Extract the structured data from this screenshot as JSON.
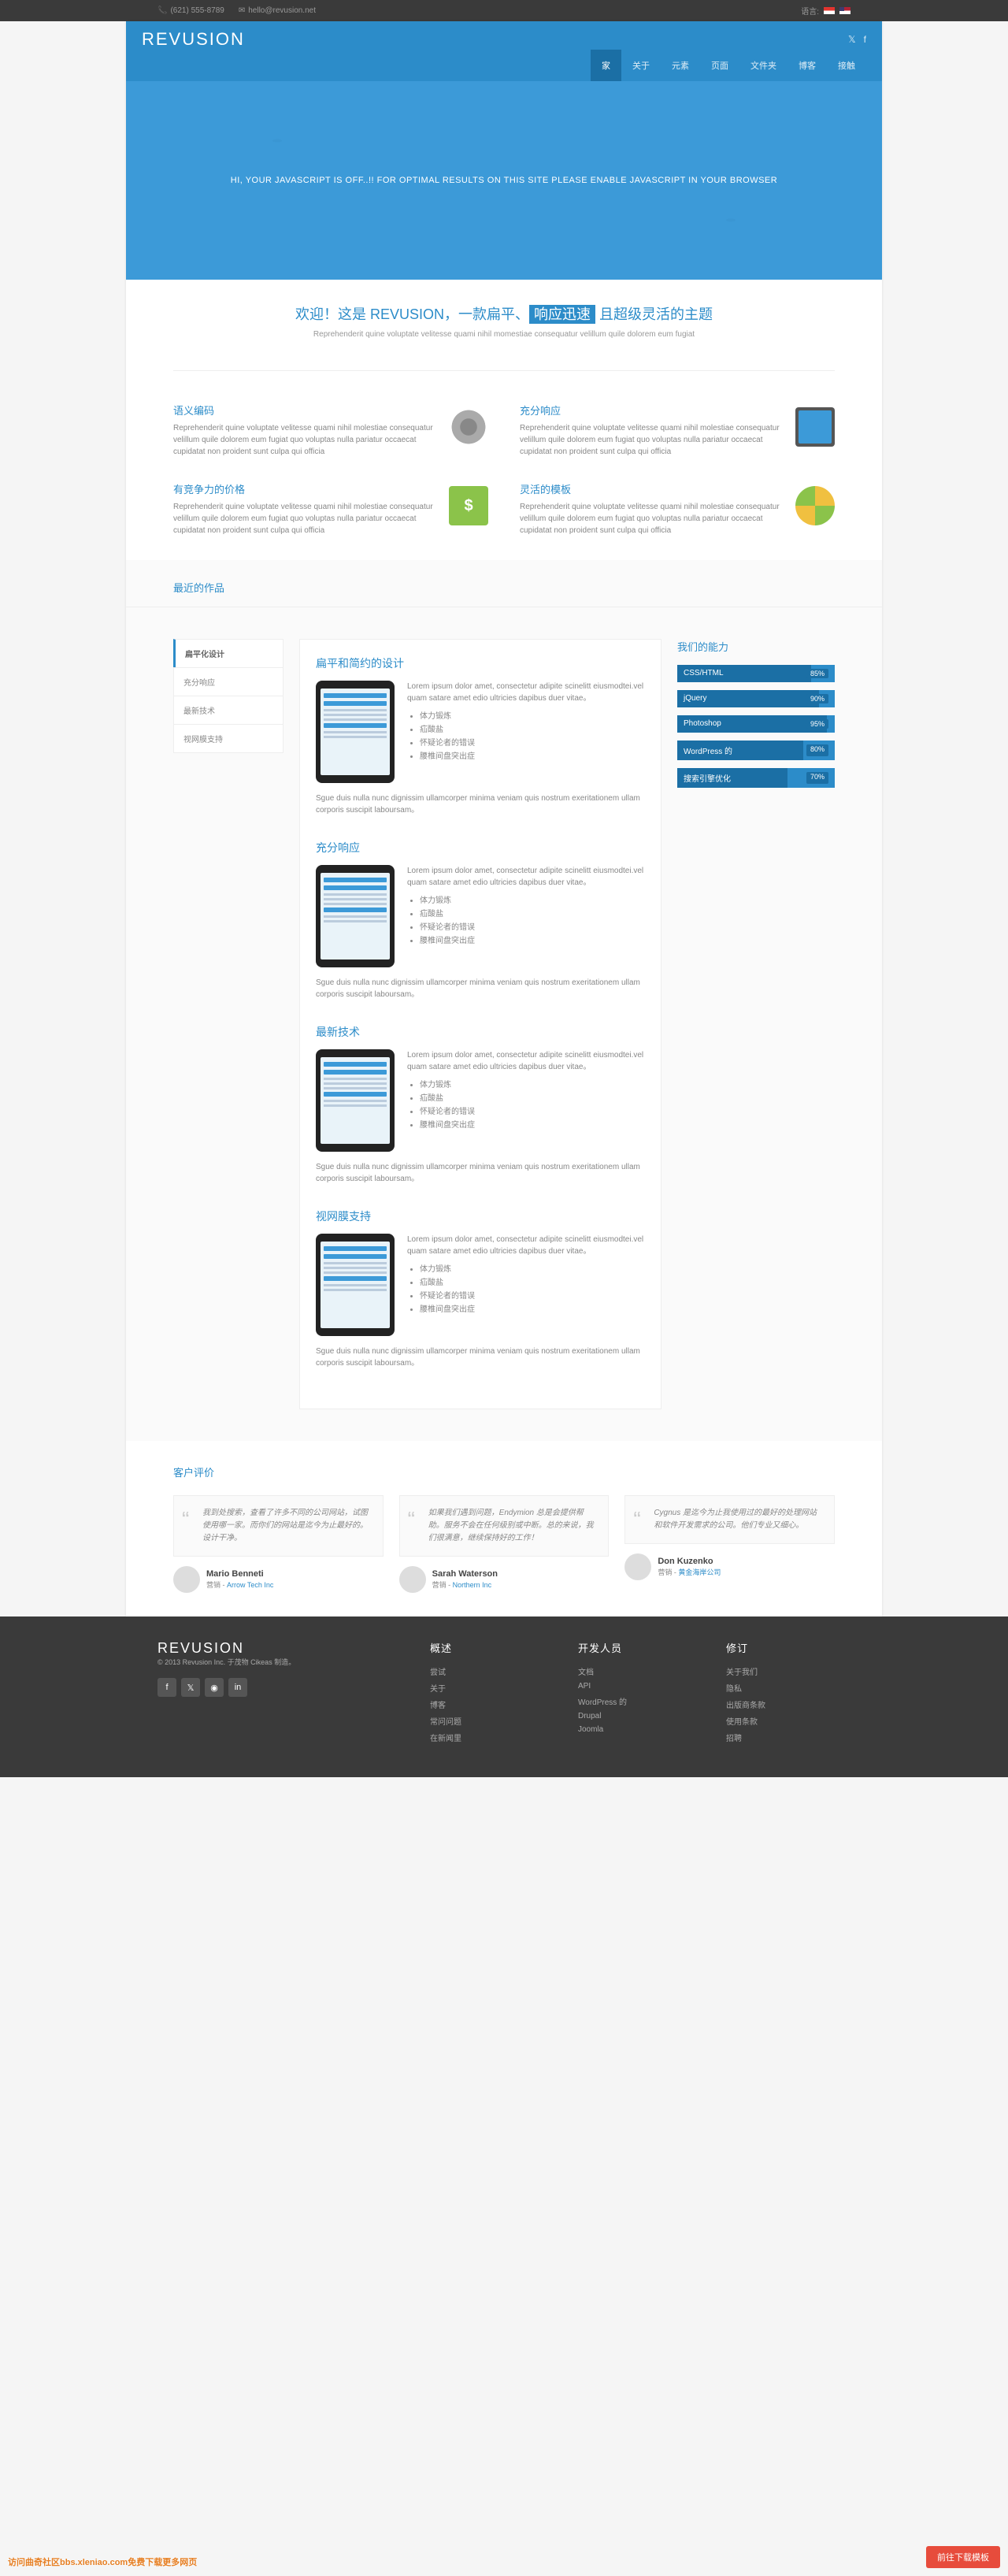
{
  "topbar": {
    "phone": "(621) 555-8789",
    "email": "hello@revusion.net",
    "lang_label": "语言:"
  },
  "header": {
    "logo": "REVUSION",
    "nav": [
      "家",
      "关于",
      "元素",
      "页面",
      "文件夹",
      "博客",
      "接触"
    ]
  },
  "hero": {
    "text": "HI, YOUR JAVASCRIPT IS OFF..!! FOR OPTIMAL RESULTS ON THIS SITE PLEASE ENABLE JAVASCRIPT IN YOUR BROWSER"
  },
  "intro": {
    "title_pre": "欢迎！这是 REVUSION，一款扁平、",
    "title_boxed": "响应迅速",
    "title_post": " 且超级灵活的主题",
    "subtitle": "Reprehenderit quine voluptate velitesse quami nihil momestiae consequatur velillum quile dolorem eum fugiat"
  },
  "features": [
    {
      "title": "语义编码",
      "desc": "Reprehenderit quine voluptate velitesse quami nihil molestiae consequatur velillum quile dolorem eum fugiat quo voluptas nulla pariatur occaecat cupidatat non proident sunt culpa qui officia",
      "icon": "gear"
    },
    {
      "title": "充分响应",
      "desc": "Reprehenderit quine voluptate velitesse quami nihil molestiae consequatur velillum quile dolorem eum fugiat quo voluptas nulla pariatur occaecat cupidatat non proident sunt culpa qui officia",
      "icon": "screen"
    },
    {
      "title": "有竞争力的价格",
      "desc": "Reprehenderit quine voluptate velitesse quami nihil molestiae consequatur velillum quile dolorem eum fugiat quo voluptas nulla pariatur occaecat cupidatat non proident sunt culpa qui officia",
      "icon": "money"
    },
    {
      "title": "灵活的模板",
      "desc": "Reprehenderit quine voluptate velitesse quami nihil molestiae consequatur velillum quile dolorem eum fugiat quo voluptas nulla pariatur occaecat cupidatat non proident sunt culpa qui officia",
      "icon": "arrows"
    }
  ],
  "recent": {
    "title": "最近的作品"
  },
  "tabs": [
    "扁平化设计",
    "充分响应",
    "最新技术",
    "视网膜支持"
  ],
  "articles": [
    {
      "title": "扁平和简约的设计"
    },
    {
      "title": "充分响应"
    },
    {
      "title": "最新技术"
    },
    {
      "title": "视网膜支持"
    }
  ],
  "article_common": {
    "intro": "Lorem ipsum dolor amet,  consectetur adipite scinelitt eiusmodtei.vel quam satare amet edio ultricies dapibus duer vitae。",
    "bullets": [
      "体力锻炼",
      "疝酸盐",
      "怀疑论者的错误",
      "腰椎间盘突出症"
    ],
    "after": "Sgue duis nulla nunc dignissim ullamcorper minima veniam quis nostrum exeritationem ullam corporis suscipit laboursam。"
  },
  "skills": {
    "title": "我们的能力",
    "items": [
      {
        "name": "CSS/HTML",
        "value": "85%",
        "w": 85
      },
      {
        "name": "jQuery",
        "value": "90%",
        "w": 90
      },
      {
        "name": "Photoshop",
        "value": "95%",
        "w": 95
      },
      {
        "name": "WordPress 的",
        "value": "80%",
        "w": 80
      },
      {
        "name": "搜索引擎优化",
        "value": "70%",
        "w": 70
      }
    ]
  },
  "testi": {
    "title": "客户评价",
    "items": [
      {
        "quote": "我到处搜索，查看了许多不同的公司网站，试图使用哪一家。而你们的网站是迄今为止最好的。设计干净。",
        "name": "Mario Benneti",
        "role": "营销 - ",
        "company": "Arrow Tech Inc"
      },
      {
        "quote": "如果我们遇到问题，Endymion 总是会提供帮助。服务不会在任何级别或中断。总的来说，我们很满意，继续保持好的工作！",
        "name": "Sarah Waterson",
        "role": "营销 - ",
        "company": "Northern Inc"
      },
      {
        "quote": "Cygnus 是迄今为止我使用过的最好的处理网站和软件开发需求的公司。他们专业又细心。",
        "name": "Don Kuzenko",
        "role": "营销 - ",
        "company": "黄金海岸公司"
      }
    ]
  },
  "footer": {
    "logo": "REVUSION",
    "copyright": "© 2013 Revusion Inc. 于茂物 Cikeas 制造。",
    "cols": [
      {
        "title": "概述",
        "links": [
          "尝试",
          "关于",
          "博客",
          "常问问题",
          "在新闻里"
        ]
      },
      {
        "title": "开发人员",
        "links": [
          "文档",
          "API",
          "WordPress 的",
          "Drupal",
          "Joomla"
        ]
      },
      {
        "title": "修订",
        "links": [
          "关于我们",
          "隐私",
          "出版商条款",
          "使用条款",
          "招聘"
        ]
      }
    ]
  },
  "download_btn": "前往下载模板",
  "watermark": "访问曲奇社区bbs.xleniao.com免费下载更多网页"
}
